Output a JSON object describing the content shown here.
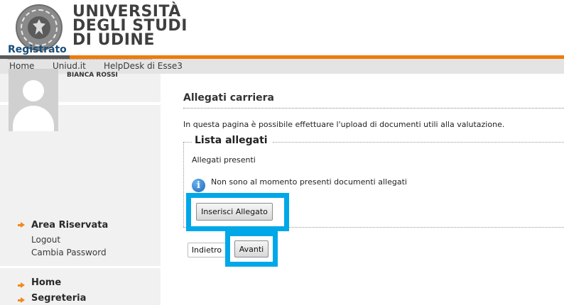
{
  "brand": {
    "university_lines": [
      "UNIVERSITÀ",
      "DEGLI STUDI",
      "DI UDINE"
    ],
    "seal_text": "UNIVERSITAS STUDIORUM UTINENSIS"
  },
  "topnav": {
    "items": [
      "Home",
      "Uniud.it",
      "HelpDesk di Esse3"
    ]
  },
  "sidebar": {
    "section_title": "Registrato",
    "user_name": "BIANCA ROSSI",
    "area_riservata": "Area Riservata",
    "logout": "Logout",
    "cambia_password": "Cambia Password",
    "nav_items": [
      "Home",
      "Segreteria"
    ]
  },
  "main": {
    "title": "Allegati carriera",
    "intro": "In questa pagina è possibile effettuare l'upload di documenti utili alla valutazione.",
    "fieldset_legend": "Lista allegati",
    "presenti_label": "Allegati presenti",
    "info_message": "Non sono al momento presenti documenti allegati",
    "insert_button": "Inserisci Allegato",
    "back_button": "Indietro",
    "next_button": "Avanti"
  },
  "colors": {
    "accent_orange": "#f07b05",
    "highlight_blue": "#00a8e8",
    "title_blue": "#1a4f7a"
  },
  "icons": [
    "university-seal-icon",
    "info-icon",
    "arrow-right-icon"
  ]
}
